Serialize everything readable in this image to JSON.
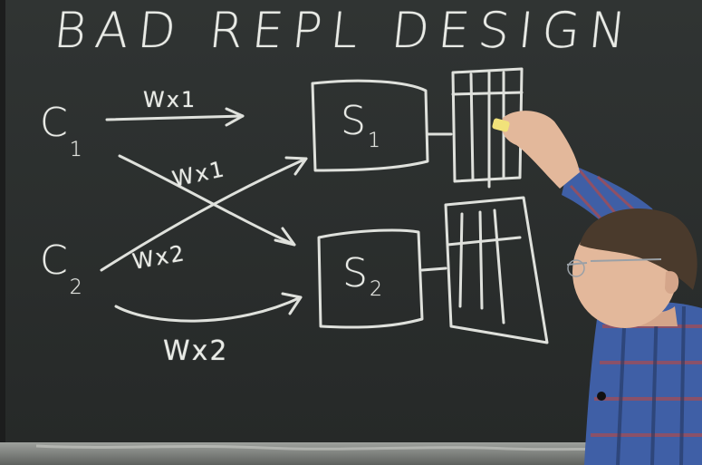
{
  "board": {
    "title": "BAD REPL DESIGN",
    "clients": [
      {
        "letter": "C",
        "sub": "1"
      },
      {
        "letter": "C",
        "sub": "2"
      }
    ],
    "servers": [
      {
        "letter": "S",
        "sub": "1"
      },
      {
        "letter": "S",
        "sub": "2"
      }
    ],
    "writes": [
      "Wx1",
      "Wx1",
      "Wx2",
      "Wx2"
    ]
  },
  "colors": {
    "board": "#2b2e2e",
    "chalk": "#e9ebe6",
    "chalk_yellow": "#f1e27a",
    "tray": "#8a8d8a",
    "shirt_blue": "#3f5fa6",
    "shirt_red": "#b24a4a",
    "hair": "#4a3a2c",
    "skin": "#e3b89b"
  }
}
